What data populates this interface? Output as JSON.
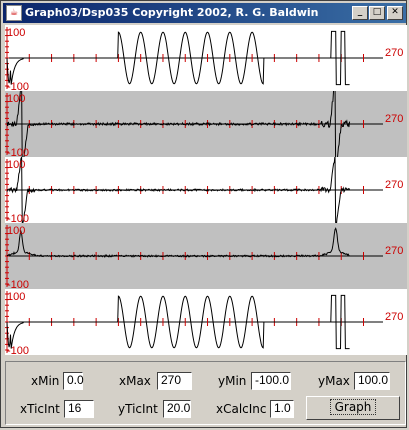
{
  "window": {
    "title": "Graph03/Dsp035 Copyright 2002, R. G. Baldwin",
    "icon": "java-cup-icon"
  },
  "colors": {
    "axis": "#000000",
    "tick": "#cc0000",
    "label": "#cc0000",
    "shaded": "#c0c0c0"
  },
  "plots": [
    {
      "top_label": "100",
      "bottom_label": "-100",
      "right_label": "270",
      "shaded": false
    },
    {
      "top_label": "100",
      "bottom_label": "-100",
      "right_label": "270",
      "shaded": true
    },
    {
      "top_label": "100",
      "bottom_label": "-100",
      "right_label": "270",
      "shaded": false
    },
    {
      "top_label": "100",
      "bottom_label": "-100",
      "right_label": "270",
      "shaded": true
    },
    {
      "top_label": "100",
      "bottom_label": "-100",
      "right_label": "270",
      "shaded": false
    }
  ],
  "controls": {
    "xmin_label": "xMin",
    "xmin_value": "0.0",
    "xmax_label": "xMax",
    "xmax_value": "270",
    "ymin_label": "yMin",
    "ymin_value": "-100.0",
    "ymax_label": "yMax",
    "ymax_value": "100.0",
    "xticint_label": "xTicInt",
    "xticint_value": "16",
    "yticint_label": "yTicInt",
    "yticint_value": "20.0",
    "xcalcinc_label": "xCalcInc",
    "xcalcinc_value": "1.0",
    "graph_button": "Graph"
  }
}
